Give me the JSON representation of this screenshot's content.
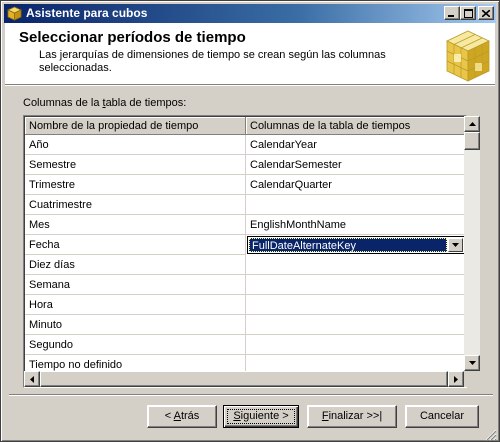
{
  "window": {
    "title": "Asistente para cubos"
  },
  "header": {
    "title": "Seleccionar períodos de tiempo",
    "subtitle": "Las jerarquías de dimensiones de tiempo se crean según las columnas seleccionadas."
  },
  "grid": {
    "caption_pre": "Columnas de la ",
    "caption_ul": "t",
    "caption_post": "abla de tiempos:",
    "headers": [
      "Nombre de la propiedad de tiempo",
      "Columnas de la tabla de tiempos"
    ],
    "rows": [
      {
        "property": "Año",
        "column": "CalendarYear"
      },
      {
        "property": "Semestre",
        "column": "CalendarSemester"
      },
      {
        "property": "Trimestre",
        "column": "CalendarQuarter"
      },
      {
        "property": "Cuatrimestre",
        "column": ""
      },
      {
        "property": "Mes",
        "column": "EnglishMonthName"
      },
      {
        "property": "Fecha",
        "column": "FullDateAlternateKey"
      },
      {
        "property": "Diez días",
        "column": ""
      },
      {
        "property": "Semana",
        "column": ""
      },
      {
        "property": "Hora",
        "column": ""
      },
      {
        "property": "Minuto",
        "column": ""
      },
      {
        "property": "Segundo",
        "column": ""
      },
      {
        "property": "Tiempo no definido",
        "column": ""
      }
    ]
  },
  "buttons": {
    "back_pre": "< ",
    "back_ul": "A",
    "back_post": "trás",
    "next_ul": "S",
    "next_post": "iguiente >",
    "finish_ul": "F",
    "finish_post": "inalizar >>|",
    "cancel": "Cancelar"
  },
  "colors": {
    "title_gradient_start": "#0a246a",
    "title_gradient_end": "#a6caf0",
    "selection": "#0a246a",
    "face": "#d4d0c8"
  }
}
